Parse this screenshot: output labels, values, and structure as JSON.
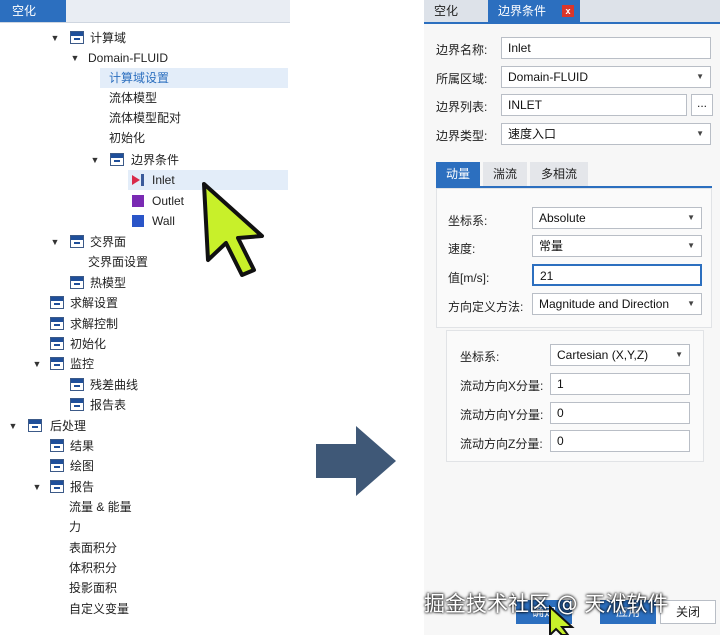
{
  "left_panel": {
    "tab": "空化",
    "tree": [
      {
        "label": "计算域"
      },
      {
        "label": "Domain-FLUID"
      },
      {
        "label": "计算域设置"
      },
      {
        "label": "流体模型"
      },
      {
        "label": "流体模型配对"
      },
      {
        "label": "初始化"
      },
      {
        "label": "边界条件"
      },
      {
        "label": "Inlet"
      },
      {
        "label": "Outlet"
      },
      {
        "label": "Wall"
      },
      {
        "label": "交界面"
      },
      {
        "label": "交界面设置"
      },
      {
        "label": "热模型"
      },
      {
        "label": "求解设置"
      },
      {
        "label": "求解控制"
      },
      {
        "label": "初始化"
      },
      {
        "label": "监控"
      },
      {
        "label": "残差曲线"
      },
      {
        "label": "报告表"
      },
      {
        "label": "后处理"
      },
      {
        "label": "结果"
      },
      {
        "label": "绘图"
      },
      {
        "label": "报告"
      },
      {
        "label": "流量 & 能量"
      },
      {
        "label": "力"
      },
      {
        "label": "表面积分"
      },
      {
        "label": "体积积分"
      },
      {
        "label": "投影面积"
      },
      {
        "label": "自定义变量"
      }
    ]
  },
  "right_panel": {
    "tabs": [
      {
        "label": "空化"
      },
      {
        "label": "边界条件"
      }
    ],
    "close_glyph": "x",
    "fields": {
      "name_label": "边界名称:",
      "name_value": "Inlet",
      "region_label": "所属区域:",
      "region_value": "Domain-FLUID",
      "list_label": "边界列表:",
      "list_value": "INLET",
      "list_button": "...",
      "type_label": "边界类型:",
      "type_value": "速度入口"
    },
    "subtabs": [
      {
        "label": "动量"
      },
      {
        "label": "湍流"
      },
      {
        "label": "多相流"
      }
    ],
    "momentum": {
      "coord_label": "坐标系:",
      "coord_value": "Absolute",
      "speed_label": "速度:",
      "speed_value": "常量",
      "value_label": "值[m/s]:",
      "value_value": "21",
      "dir_label": "方向定义方法:",
      "dir_value": "Magnitude and Direction"
    },
    "direction": {
      "coord_label": "坐标系:",
      "coord_value": "Cartesian (X,Y,Z)",
      "x_label": "流动方向X分量:",
      "x_value": "1",
      "y_label": "流动方向Y分量:",
      "y_value": "0",
      "z_label": "流动方向Z分量:",
      "z_value": "0"
    },
    "buttons": {
      "ok": "确定",
      "apply": "应用",
      "cancel": "关闭"
    }
  },
  "watermark": "掘金技术社区 @ 天洑软件",
  "colors": {
    "accent": "#2c6fbf",
    "close": "#d9362b",
    "cursor": "#c8f02a",
    "arrow": "#3f5877"
  }
}
